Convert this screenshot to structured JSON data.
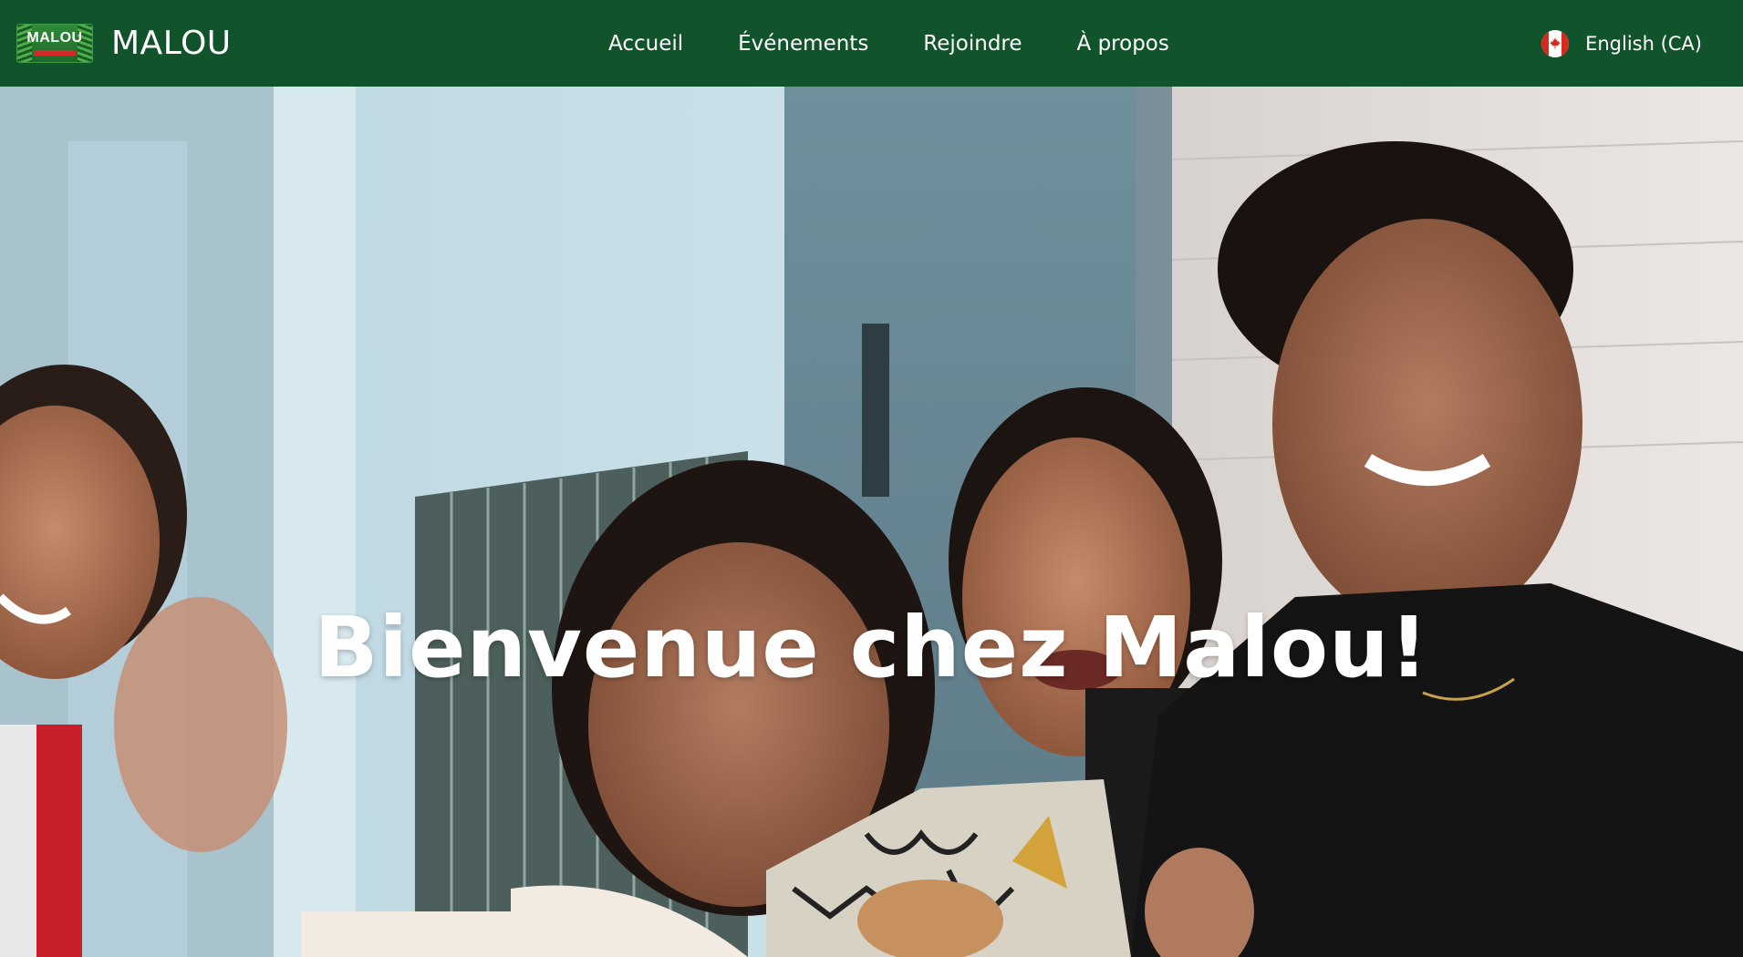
{
  "navbar": {
    "brand": {
      "logo_text": "MALOU",
      "name": "MALOU"
    },
    "links": [
      {
        "label": "Accueil"
      },
      {
        "label": "Événements"
      },
      {
        "label": "Rejoindre"
      },
      {
        "label": "À propos"
      }
    ],
    "language": {
      "icon": "canada-flag-icon",
      "label": "English (CA)"
    }
  },
  "hero": {
    "title": "Bienvenue chez Malou!",
    "image": "group-photo-waving"
  },
  "colors": {
    "navbar_bg": "#11532a",
    "text": "#ffffff",
    "flag_red": "#d52b1e"
  }
}
